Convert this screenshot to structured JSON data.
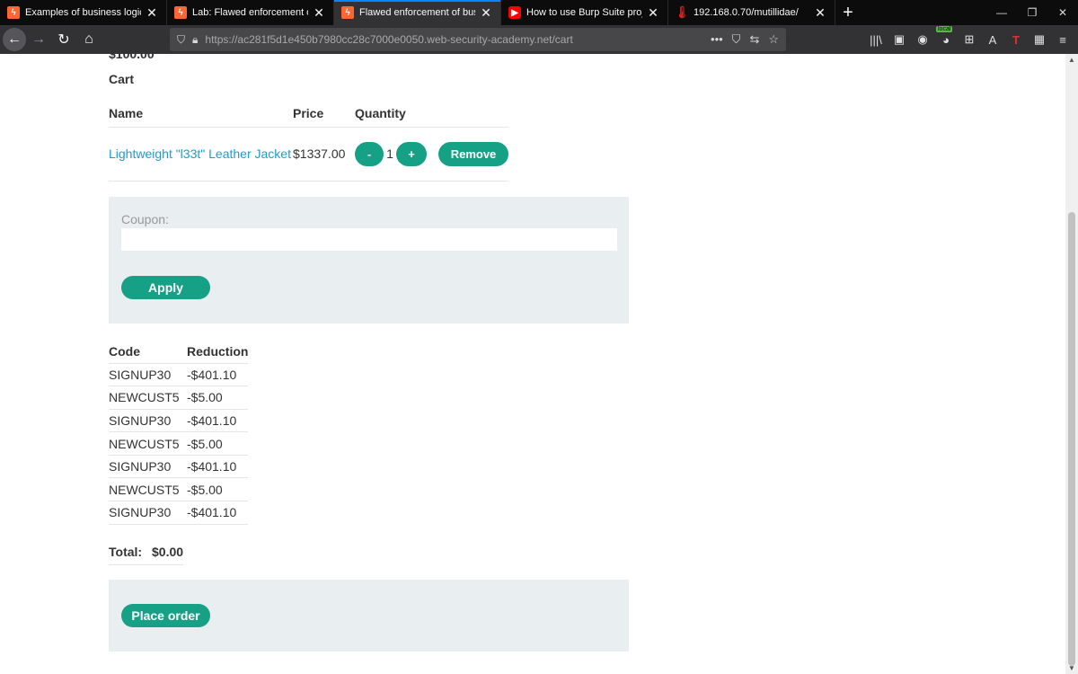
{
  "browser": {
    "tabs": [
      {
        "title": "Examples of business logic vuln",
        "favicon": "portswigger-icon",
        "active": false
      },
      {
        "title": "Lab: Flawed enforcement of bu",
        "favicon": "portswigger-icon",
        "active": false
      },
      {
        "title": "Flawed enforcement of business",
        "favicon": "portswigger-icon",
        "active": true
      },
      {
        "title": "How to use Burp Suite projects",
        "favicon": "youtube-icon",
        "active": false
      },
      {
        "title": "192.168.0.70/mutillidae/",
        "favicon": "thermometer-icon",
        "active": false
      }
    ],
    "url_main": "https://ac281f5d1e450b7980cc28c7000e0050.web-security-academy.net",
    "url_path": "/cart",
    "extension_badge": "local",
    "accent_color": "#0a84ff"
  },
  "page": {
    "previous_total": "$100.00",
    "cart_heading": "Cart",
    "cart_columns": {
      "name": "Name",
      "price": "Price",
      "quantity": "Quantity"
    },
    "cart_items": [
      {
        "name": "Lightweight \"l33t\" Leather Jacket",
        "price": "$1337.00",
        "quantity": "1",
        "minus_label": "-",
        "plus_label": "+",
        "remove_label": "Remove"
      }
    ],
    "coupon": {
      "label": "Coupon:",
      "value": "",
      "apply_label": "Apply"
    },
    "reductions": {
      "columns": {
        "code": "Code",
        "reduction": "Reduction"
      },
      "rows": [
        {
          "code": "SIGNUP30",
          "reduction": "-$401.10"
        },
        {
          "code": "NEWCUST5",
          "reduction": "-$5.00"
        },
        {
          "code": "SIGNUP30",
          "reduction": "-$401.10"
        },
        {
          "code": "NEWCUST5",
          "reduction": "-$5.00"
        },
        {
          "code": "SIGNUP30",
          "reduction": "-$401.10"
        },
        {
          "code": "NEWCUST5",
          "reduction": "-$5.00"
        },
        {
          "code": "SIGNUP30",
          "reduction": "-$401.10"
        }
      ]
    },
    "total": {
      "label": "Total:",
      "value": "$0.00"
    },
    "place_order_label": "Place order",
    "button_color": "#16a085",
    "link_color": "#1e9cce"
  }
}
